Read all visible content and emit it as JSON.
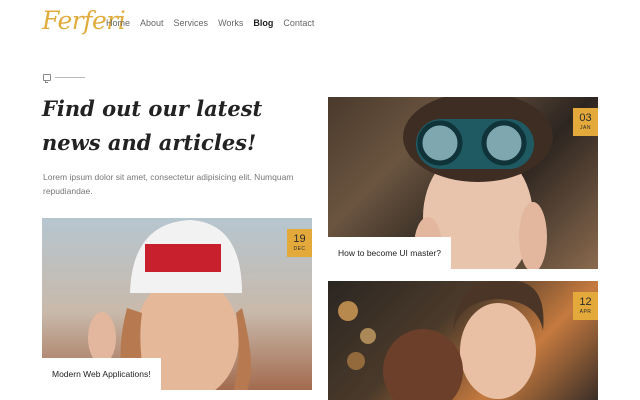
{
  "header": {
    "logo": "Ferferi",
    "nav": [
      {
        "label": "Home",
        "active": false
      },
      {
        "label": "About",
        "active": false
      },
      {
        "label": "Services",
        "active": false
      },
      {
        "label": "Works",
        "active": false
      },
      {
        "label": "Blog",
        "active": true
      },
      {
        "label": "Contact",
        "active": false
      }
    ]
  },
  "section": {
    "icon": "chat-icon",
    "headline": "Find out our latest news and articles!",
    "intro": "Lorem ipsum dolor sit amet, consectetur adipisicing elit. Numquam repudiandae."
  },
  "posts": [
    {
      "day": "03",
      "month": "JAN",
      "title": "How to become UI master?"
    },
    {
      "day": "19",
      "month": "DEC",
      "title": "Modern Web Applications!"
    },
    {
      "day": "12",
      "month": "APR",
      "title": ""
    }
  ],
  "colors": {
    "accent": "#e3a93b",
    "logo": "#e0ac3c"
  }
}
